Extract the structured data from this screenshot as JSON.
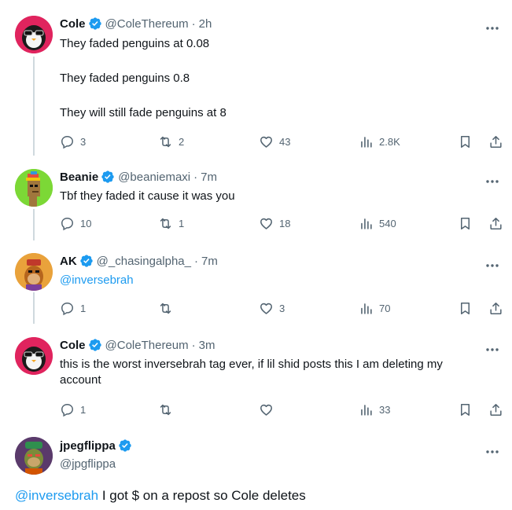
{
  "tweets": [
    {
      "name": "Cole",
      "handle": "@ColeThereum",
      "time": "2h",
      "lines": [
        "They faded penguins at 0.08",
        "They faded penguins 0.8",
        "They will still fade penguins at 8"
      ],
      "replies": "3",
      "reposts": "2",
      "likes": "43",
      "views": "2.8K"
    },
    {
      "name": "Beanie",
      "handle": "@beaniemaxi",
      "time": "7m",
      "text": "Tbf they faded it cause it was you",
      "replies": "10",
      "reposts": "1",
      "likes": "18",
      "views": "540"
    },
    {
      "name": "AK",
      "handle": "@_chasingalpha_",
      "time": "7m",
      "mention": "@inversebrah",
      "replies": "1",
      "reposts": "",
      "likes": "3",
      "views": "70"
    },
    {
      "name": "Cole",
      "handle": "@ColeThereum",
      "time": "3m",
      "text_line1": "this is the worst inversebrah tag ever, if lil shid posts this I am deleting my",
      "text_line2": "account",
      "replies": "1",
      "reposts": "",
      "likes": "",
      "views": "33"
    }
  ],
  "main_tweet": {
    "name": "jpegflippa",
    "handle": "@jpgflippa",
    "mention": "@inversebrah",
    "text": " I got $ on a repost so Cole deletes"
  },
  "separator": "·",
  "icons": [
    "reply-icon",
    "repost-icon",
    "like-icon",
    "views-icon",
    "bookmark-icon",
    "share-icon",
    "more-icon",
    "verified-badge-icon"
  ],
  "colors": {
    "accent": "#1d9bf0",
    "secondary_text": "#536471",
    "thread_line": "#cfd9de"
  }
}
